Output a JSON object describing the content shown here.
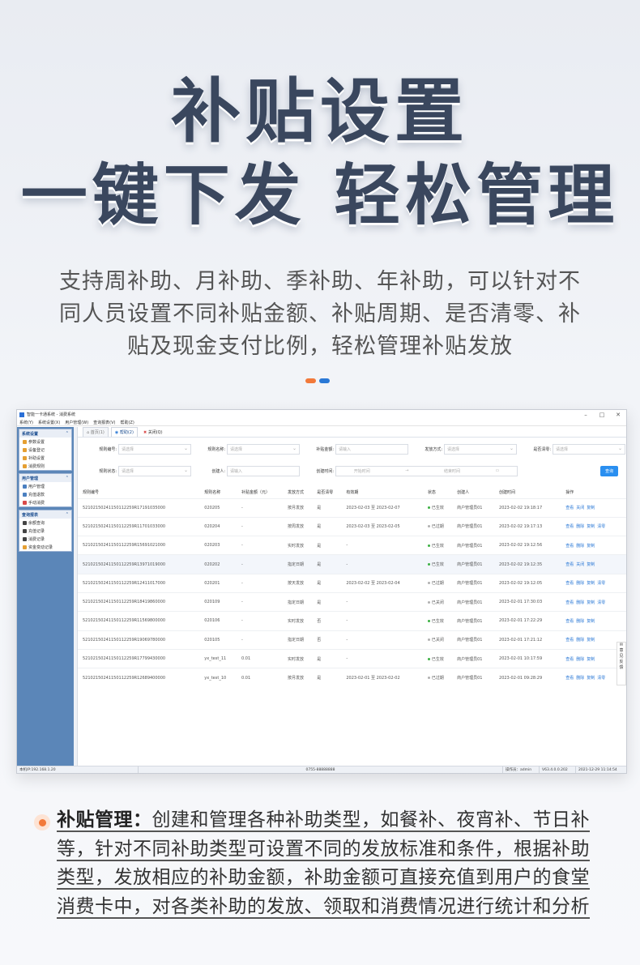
{
  "hero": {
    "line1": "补贴设置",
    "line2": "一键下发 轻松管理"
  },
  "subtitle": {
    "line1": "支持周补助、月补助、季补助、年补助，可以针对不",
    "line2": "同人员设置不同补贴金额、补贴周期、是否清零、补",
    "line3": "贴及现金支付比例，轻松管理补贴发放"
  },
  "colors": {
    "accent_orange": "#f2793a",
    "accent_blue": "#2a78d6",
    "title_color": "#3a475e"
  },
  "window": {
    "title": "智能一卡通系统 - 消费系统",
    "controls": [
      "–",
      "□",
      "✕"
    ],
    "menu": [
      "系统(Y)",
      "系统设置(X)",
      "用户管理(W)",
      "查询报表(V)",
      "帮助(Z)"
    ],
    "sidebar": [
      {
        "header": "系统设置",
        "items": [
          "参数设置",
          "设备登记",
          "补助设置",
          "消费规则"
        ]
      },
      {
        "header": "用户管理",
        "items": [
          "用户管理",
          "充值退款",
          "手动消费"
        ]
      },
      {
        "header": "查询报表",
        "items": [
          "余额查询",
          "充值记录",
          "消费记录",
          "资金变动记录"
        ]
      }
    ],
    "tabs": [
      {
        "label": "首页(1)",
        "icon": "home-icon"
      },
      {
        "label": "帮助(2)",
        "icon": "help-icon"
      },
      {
        "label": "关闭(Q)",
        "icon": "close-icon"
      }
    ],
    "filters": {
      "row1": [
        {
          "label": "规则编号:",
          "placeholder": "请选择",
          "select": true
        },
        {
          "label": "规则名称:",
          "placeholder": "请选择",
          "select": true
        },
        {
          "label": "补贴金额:",
          "placeholder": "请输入",
          "select": false
        },
        {
          "label": "发放方式:",
          "placeholder": "请选择",
          "select": true
        },
        {
          "label": "是否清零:",
          "placeholder": "请选择",
          "select": true
        }
      ],
      "row2": [
        {
          "label": "规则状态:",
          "placeholder": "请选择",
          "select": true
        },
        {
          "label": "创建人:",
          "placeholder": "请输入",
          "select": false
        }
      ],
      "created_label": "创建时间:",
      "date_start": "开始时间",
      "date_sep": "→",
      "date_end": "结束时间",
      "query_button": "查询"
    },
    "table": {
      "columns": [
        "规则编号",
        "规则名称",
        "补贴金额（元）",
        "发放方式",
        "是否清零",
        "有效期",
        "状态",
        "创建人",
        "创建时间",
        "操作"
      ],
      "rows": [
        {
          "id": "5210215024115011225​9R17191035000",
          "name": "020205",
          "amount": "-",
          "mode": "按月发放",
          "clear": "是",
          "valid": "2023-02-03 至 2023-02-07",
          "status": "已生效",
          "status_color": "#3cb043",
          "creator": "商户管理员01",
          "created": "2023-02-02 19:18:17",
          "actions": [
            "查看",
            "关闭",
            "复制"
          ]
        },
        {
          "id": "5210215024115011225​9R11701033000",
          "name": "020204",
          "amount": "-",
          "mode": "按周发放",
          "clear": "是",
          "valid": "2023-02-03 至 2023-02-05",
          "status": "已过期",
          "status_color": "#b0b0b0",
          "creator": "商户管理员01",
          "created": "2023-02-02 19:17:13",
          "actions": [
            "查看",
            "删除",
            "复制",
            "清零"
          ]
        },
        {
          "id": "5210215024115011225​9R15691021000",
          "name": "020203",
          "amount": "-",
          "mode": "实时发放",
          "clear": "是",
          "valid": "-",
          "status": "已生效",
          "status_color": "#3cb043",
          "creator": "商户管理员01",
          "created": "2023-02-02 19:12:56",
          "actions": [
            "查看",
            "删除",
            "复制"
          ]
        },
        {
          "id": "5210215024115011225​9R13971019000",
          "name": "020202",
          "amount": "-",
          "mode": "指定日期",
          "clear": "是",
          "valid": "-",
          "status": "已生效",
          "status_color": "#3cb043",
          "creator": "商户管理员01",
          "created": "2023-02-02 19:12:35",
          "actions": [
            "查看",
            "关闭",
            "复制"
          ]
        },
        {
          "id": "5210215024115011225​9R12411017000",
          "name": "020201",
          "amount": "-",
          "mode": "按天发放",
          "clear": "是",
          "valid": "2023-02-02 至 2023-02-04",
          "status": "已过期",
          "status_color": "#b0b0b0",
          "creator": "商户管理员01",
          "created": "2023-02-02 19:12:05",
          "actions": [
            "查看",
            "删除",
            "复制",
            "清零"
          ]
        },
        {
          "id": "5210215024115011225​9R18419860000",
          "name": "020109",
          "amount": "-",
          "mode": "指定日期",
          "clear": "是",
          "valid": "-",
          "status": "已关闭",
          "status_color": "#b0b0b0",
          "creator": "商户管理员01",
          "created": "2023-02-01 17:30:03",
          "actions": [
            "查看",
            "删除",
            "复制",
            "清零"
          ]
        },
        {
          "id": "5210215024115011225​9R11569800000",
          "name": "020106",
          "amount": "-",
          "mode": "实时发放",
          "clear": "否",
          "valid": "-",
          "status": "已生效",
          "status_color": "#3cb043",
          "creator": "商户管理员01",
          "created": "2023-02-01 17:22:29",
          "actions": [
            "查看",
            "删除",
            "复制"
          ]
        },
        {
          "id": "5210215024115011225​9R19069780000",
          "name": "020105",
          "amount": "-",
          "mode": "指定日期",
          "clear": "否",
          "valid": "-",
          "status": "已关闭",
          "status_color": "#b0b0b0",
          "creator": "商户管理员01",
          "created": "2023-02-01 17:21:12",
          "actions": [
            "查看",
            "删除",
            "复制"
          ]
        },
        {
          "id": "5210215024115011225​9R17799430000",
          "name": "yx_test_11",
          "amount": "0.01",
          "mode": "实时发放",
          "clear": "是",
          "valid": "-",
          "status": "已生效",
          "status_color": "#3cb043",
          "creator": "商户管理员01",
          "created": "2023-02-01 10:17:59",
          "actions": [
            "查看",
            "删除",
            "复制"
          ]
        },
        {
          "id": "5210215024115011225​9R12689400000",
          "name": "yx_test_10",
          "amount": "0.01",
          "mode": "按月发放",
          "clear": "是",
          "valid": "2023-02-01 至 2023-02-02",
          "status": "已过期",
          "status_color": "#b0b0b0",
          "creator": "商户管理员01",
          "created": "2023-02-01 09:28:29",
          "actions": [
            "查看",
            "删除",
            "复制",
            "清零"
          ]
        }
      ]
    },
    "feedback": "意见反馈",
    "statusbar": [
      "本机IP:192.168.1.20",
      "0755-88888888",
      "操作员：admin",
      "V63.4.0.0.202",
      "2021-12-29 11:14:54"
    ]
  },
  "description": {
    "label": "补贴管理：",
    "line1": "创建和管理各种补助类型，如餐补、夜宵补、节日补",
    "line2": "等，针对不同补助类型可设置不同的发放标准和条件，根据补助",
    "line3": "类型，发放相应的补助金额，补助金额可直接充值到用户的食堂",
    "line4": "消费卡中，对各类补助的发放、领取和消费情况进行统计和分析"
  }
}
